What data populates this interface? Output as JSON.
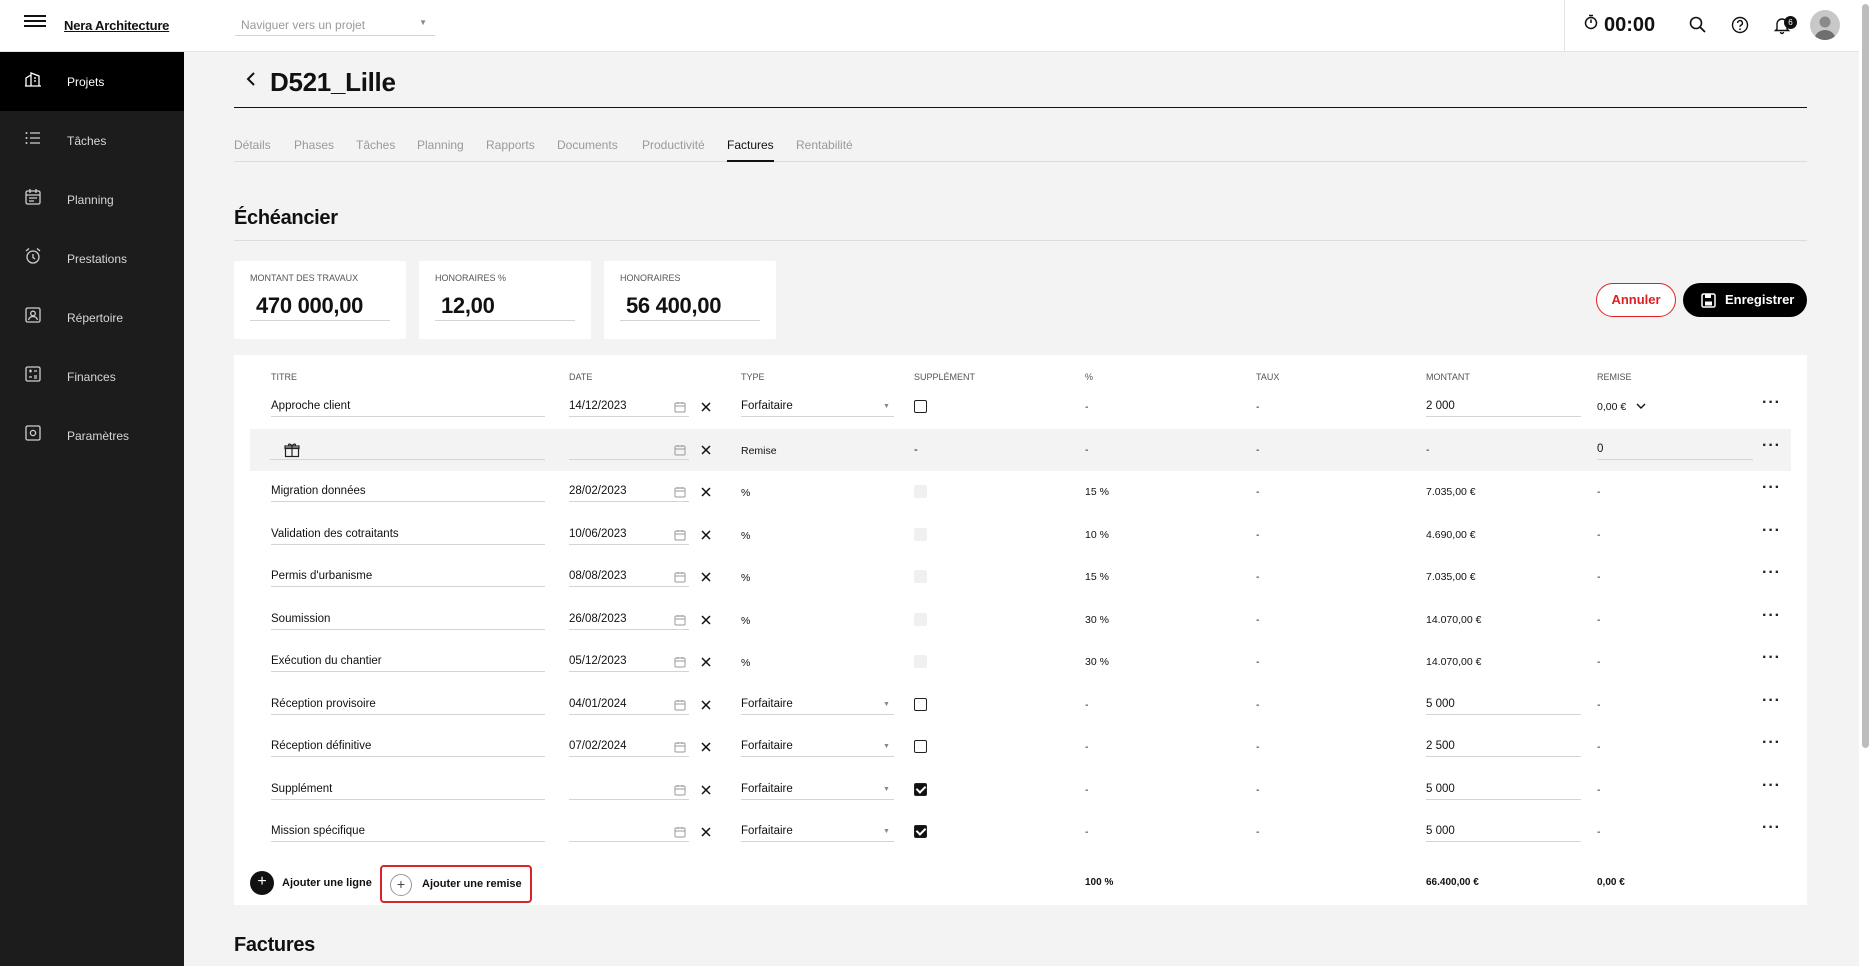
{
  "topbar": {
    "brand": "Nera Architecture",
    "nav_placeholder": "Naviguer vers un projet",
    "timer": "00:00",
    "notif_count": "6"
  },
  "sidebar": {
    "items": [
      {
        "label": "Projets",
        "icon": "buildings-icon"
      },
      {
        "label": "Tâches",
        "icon": "list-icon"
      },
      {
        "label": "Planning",
        "icon": "calendar-icon"
      },
      {
        "label": "Prestations",
        "icon": "alarm-clock-icon"
      },
      {
        "label": "Répertoire",
        "icon": "contacts-icon"
      },
      {
        "label": "Finances",
        "icon": "finance-icon"
      },
      {
        "label": "Paramètres",
        "icon": "settings-icon"
      }
    ]
  },
  "project": {
    "title": "D521_Lille",
    "tabs": [
      "Détails",
      "Phases",
      "Tâches",
      "Planning",
      "Rapports",
      "Documents",
      "Productivité",
      "Factures",
      "Rentabilité"
    ]
  },
  "schedule": {
    "title": "Échéancier",
    "cards": [
      {
        "label": "MONTANT DES TRAVAUX",
        "value": "470 000,00"
      },
      {
        "label": "HONORAIRES %",
        "value": "12,00"
      },
      {
        "label": "HONORAIRES",
        "value": "56 400,00"
      }
    ],
    "cancel_label": "Annuler",
    "save_label": "Enregistrer"
  },
  "table": {
    "headers": [
      "TITRE",
      "DATE",
      "TYPE",
      "SUPPLÉMENT",
      "%",
      "TAUX",
      "MONTANT",
      "REMISE"
    ],
    "rows": [
      {
        "title": "Approche client",
        "date": "14/12/2023",
        "type": "Forfaitaire",
        "supp": "-",
        "pct": "-",
        "taux": "-",
        "montant": "2 000",
        "remise": "0,00 €"
      },
      {
        "title": "",
        "date": "",
        "type": "Remise",
        "supp": "-",
        "pct": "-",
        "taux": "-",
        "montant": "-",
        "remise": "0"
      },
      {
        "title": "Migration données",
        "date": "28/02/2023",
        "type": "%",
        "supp": "",
        "pct": "15 %",
        "taux": "-",
        "montant": "7.035,00 €",
        "remise": "-"
      },
      {
        "title": "Validation des cotraitants",
        "date": "10/06/2023",
        "type": "%",
        "supp": "",
        "pct": "10 %",
        "taux": "-",
        "montant": "4.690,00 €",
        "remise": "-"
      },
      {
        "title": "Permis d'urbanisme",
        "date": "08/08/2023",
        "type": "%",
        "supp": "",
        "pct": "15 %",
        "taux": "-",
        "montant": "7.035,00 €",
        "remise": "-"
      },
      {
        "title": "Soumission",
        "date": "26/08/2023",
        "type": "%",
        "supp": "",
        "pct": "30 %",
        "taux": "-",
        "montant": "14.070,00 €",
        "remise": "-"
      },
      {
        "title": "Exécution du chantier",
        "date": "05/12/2023",
        "type": "%",
        "supp": "",
        "pct": "30 %",
        "taux": "-",
        "montant": "14.070,00 €",
        "remise": "-"
      },
      {
        "title": "Réception provisoire",
        "date": "04/01/2024",
        "type": "Forfaitaire",
        "supp": "",
        "pct": "-",
        "taux": "-",
        "montant": "5 000",
        "remise": "-"
      },
      {
        "title": "Réception définitive",
        "date": "07/02/2024",
        "type": "Forfaitaire",
        "supp": "",
        "pct": "-",
        "taux": "-",
        "montant": "2 500",
        "remise": "-"
      },
      {
        "title": "Supplément",
        "date": "",
        "type": "Forfaitaire",
        "supp": "",
        "pct": "-",
        "taux": "-",
        "montant": "5 000",
        "remise": "-"
      },
      {
        "title": "Mission spécifique",
        "date": "",
        "type": "Forfaitaire",
        "supp": "",
        "pct": "-",
        "taux": "-",
        "montant": "5 000",
        "remise": "-"
      }
    ],
    "add_line_label": "Ajouter une ligne",
    "add_remise_label": "Ajouter une remise",
    "total_pct": "100 %",
    "total_montant": "66.400,00 €",
    "total_remise": "0,00 €"
  },
  "invoices": {
    "title": "Factures"
  }
}
